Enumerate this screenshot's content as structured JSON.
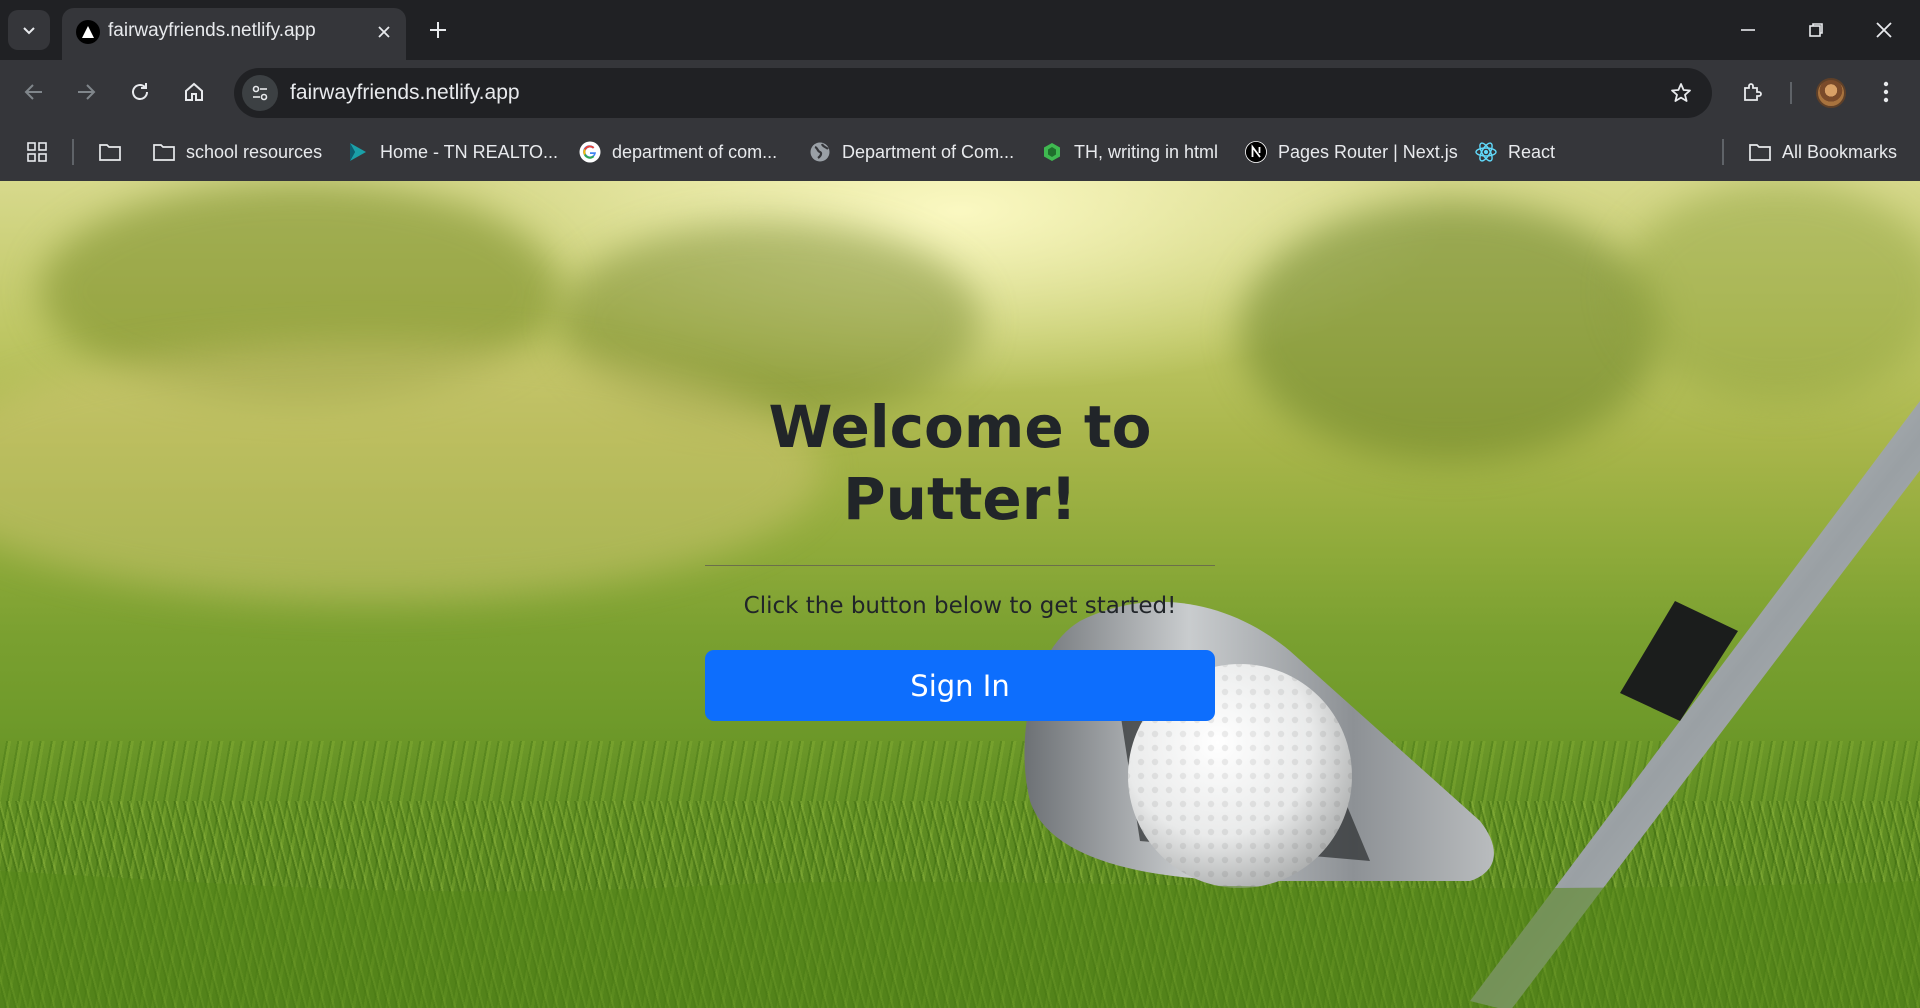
{
  "browser": {
    "tab": {
      "title": "fairwayfriends.netlify.app"
    },
    "url": "fairwayfriends.netlify.app",
    "bookmarks": [
      {
        "label": "school resources",
        "icon": "folder-icon"
      },
      {
        "label": "Home - TN REALTO...",
        "icon": "realtor-icon"
      },
      {
        "label": "department of com...",
        "icon": "google-icon"
      },
      {
        "label": "Department of Com...",
        "icon": "globe-icon"
      },
      {
        "label": "TH, writing in html",
        "icon": "codesandbox-icon"
      },
      {
        "label": "Pages Router | Next.js",
        "icon": "nextjs-icon"
      },
      {
        "label": "React",
        "icon": "react-icon"
      }
    ],
    "all_bookmarks": "All Bookmarks"
  },
  "page": {
    "title": "Welcome to Putter!",
    "subtitle": "Click the button below to get started!",
    "signin_label": "Sign In"
  },
  "colors": {
    "primary_button": "#0d6efd",
    "chrome_dark": "#202124",
    "chrome_toolbar": "#35363a"
  }
}
